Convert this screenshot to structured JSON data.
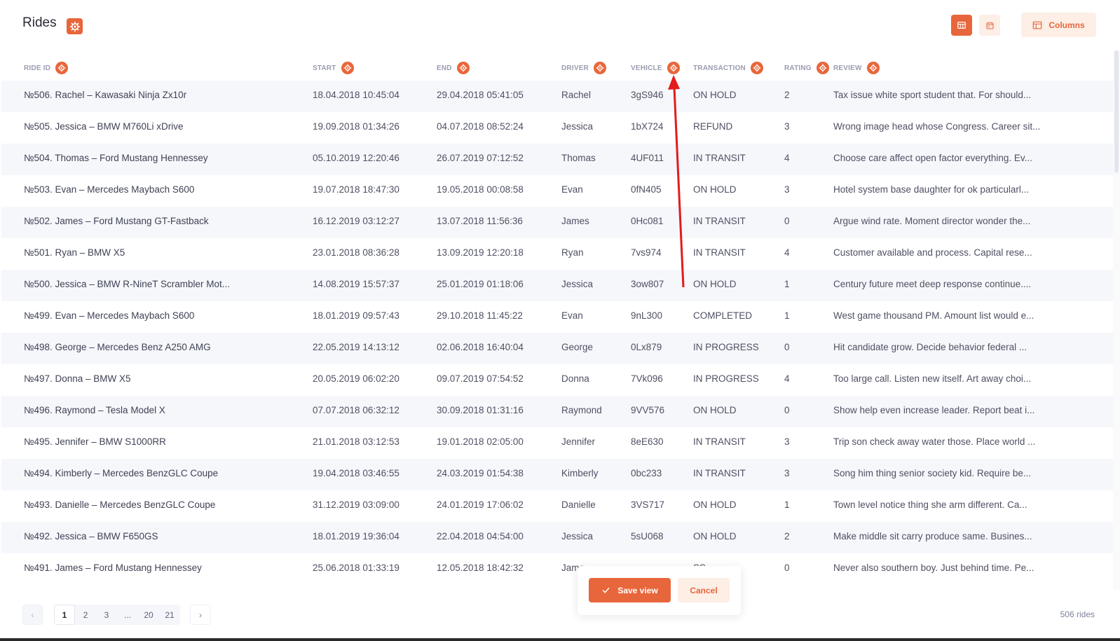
{
  "header": {
    "title": "Rides",
    "columns_label": "Columns"
  },
  "columns": [
    "Ride ID",
    "Start",
    "End",
    "Driver",
    "Vehicle",
    "Transaction",
    "Rating",
    "Review"
  ],
  "rows": [
    {
      "id": "№506. Rachel – Kawasaki Ninja Zx10r",
      "start": "18.04.2018 10:45:04",
      "end": "29.04.2018 05:41:05",
      "driver": "Rachel",
      "vehicle": "3gS946",
      "transaction": "ON HOLD",
      "rating": "2",
      "review": "Tax issue white sport student that. For should..."
    },
    {
      "id": "№505. Jessica – BMW M760Li xDrive",
      "start": "19.09.2018 01:34:26",
      "end": "04.07.2018 08:52:24",
      "driver": "Jessica",
      "vehicle": "1bX724",
      "transaction": "REFUND",
      "rating": "3",
      "review": "Wrong image head whose Congress. Career sit..."
    },
    {
      "id": "№504. Thomas – Ford Mustang Hennessey",
      "start": "05.10.2019 12:20:46",
      "end": "26.07.2019 07:12:52",
      "driver": "Thomas",
      "vehicle": "4UF011",
      "transaction": "IN TRANSIT",
      "rating": "4",
      "review": "Choose care affect open factor everything. Ev..."
    },
    {
      "id": "№503. Evan – Mercedes Maybach S600",
      "start": "19.07.2018 18:47:30",
      "end": "19.05.2018 00:08:58",
      "driver": "Evan",
      "vehicle": "0fN405",
      "transaction": "ON HOLD",
      "rating": "3",
      "review": "Hotel system base daughter for ok particularl..."
    },
    {
      "id": "№502. James – Ford Mustang GT-Fastback",
      "start": "16.12.2019 03:12:27",
      "end": "13.07.2018 11:56:36",
      "driver": "James",
      "vehicle": "0Hc081",
      "transaction": "IN TRANSIT",
      "rating": "0",
      "review": "Argue wind rate. Moment director wonder the..."
    },
    {
      "id": "№501. Ryan – BMW X5",
      "start": "23.01.2018 08:36:28",
      "end": "13.09.2019 12:20:18",
      "driver": "Ryan",
      "vehicle": "7vs974",
      "transaction": "IN TRANSIT",
      "rating": "4",
      "review": "Customer available and process. Capital rese..."
    },
    {
      "id": "№500. Jessica – BMW R-NineT Scrambler Mot...",
      "start": "14.08.2019 15:57:37",
      "end": "25.01.2019 01:18:06",
      "driver": "Jessica",
      "vehicle": "3ow807",
      "transaction": "ON HOLD",
      "rating": "1",
      "review": "Century future meet deep response continue...."
    },
    {
      "id": "№499. Evan – Mercedes Maybach S600",
      "start": "18.01.2019 09:57:43",
      "end": "29.10.2018 11:45:22",
      "driver": "Evan",
      "vehicle": "9nL300",
      "transaction": "COMPLETED",
      "rating": "1",
      "review": "West game thousand PM. Amount list would e..."
    },
    {
      "id": "№498. George – Mercedes Benz A250 AMG",
      "start": "22.05.2019 14:13:12",
      "end": "02.06.2018 16:40:04",
      "driver": "George",
      "vehicle": "0Lx879",
      "transaction": "IN PROGRESS",
      "rating": "0",
      "review": "Hit candidate grow. Decide behavior federal ..."
    },
    {
      "id": "№497. Donna – BMW X5",
      "start": "20.05.2019 06:02:20",
      "end": "09.07.2019 07:54:52",
      "driver": "Donna",
      "vehicle": "7Vk096",
      "transaction": "IN PROGRESS",
      "rating": "4",
      "review": "Too large call. Listen new itself. Art away choi..."
    },
    {
      "id": "№496. Raymond – Tesla Model X",
      "start": "07.07.2018 06:32:12",
      "end": "30.09.2018 01:31:16",
      "driver": "Raymond",
      "vehicle": "9VV576",
      "transaction": "ON HOLD",
      "rating": "0",
      "review": "Show help even increase leader. Report beat i..."
    },
    {
      "id": "№495. Jennifer – BMW S1000RR",
      "start": "21.01.2018 03:12:53",
      "end": "19.01.2018 02:05:00",
      "driver": "Jennifer",
      "vehicle": "8eE630",
      "transaction": "IN TRANSIT",
      "rating": "3",
      "review": "Trip son check away water those. Place world ..."
    },
    {
      "id": "№494. Kimberly – Mercedes BenzGLC Coupe",
      "start": "19.04.2018 03:46:55",
      "end": "24.03.2019 01:54:38",
      "driver": "Kimberly",
      "vehicle": "0bc233",
      "transaction": "IN TRANSIT",
      "rating": "3",
      "review": "Song him thing senior society kid. Require be..."
    },
    {
      "id": "№493. Danielle – Mercedes BenzGLC Coupe",
      "start": "31.12.2019 03:09:00",
      "end": "24.01.2019 17:06:02",
      "driver": "Danielle",
      "vehicle": "3VS717",
      "transaction": "ON HOLD",
      "rating": "1",
      "review": "Town level notice thing she arm different. Ca..."
    },
    {
      "id": "№492. Jessica – BMW F650GS",
      "start": "18.01.2019 19:36:04",
      "end": "22.04.2018 04:54:00",
      "driver": "Jessica",
      "vehicle": "5sU068",
      "transaction": "ON HOLD",
      "rating": "2",
      "review": "Make middle sit carry produce same. Busines..."
    },
    {
      "id": "№491. James – Ford Mustang Hennessey",
      "start": "25.06.2018 01:33:19",
      "end": "12.05.2018 18:42:32",
      "driver": "Jame",
      "vehicle": "",
      "transaction": "SS",
      "rating": "0",
      "review": "Never also southern boy. Just behind time. Pe..."
    }
  ],
  "pagination": {
    "prev": "‹",
    "pages": [
      "1",
      "2",
      "3"
    ],
    "dots": "...",
    "tail": [
      "20",
      "21"
    ],
    "next": "›",
    "count": "506 rides"
  },
  "save_bar": {
    "save_label": "Save view",
    "cancel_label": "Cancel"
  },
  "colors": {
    "accent": "#e8663b",
    "accent_light": "#fdeee6",
    "annotation_arrow": "#e31b1b"
  }
}
